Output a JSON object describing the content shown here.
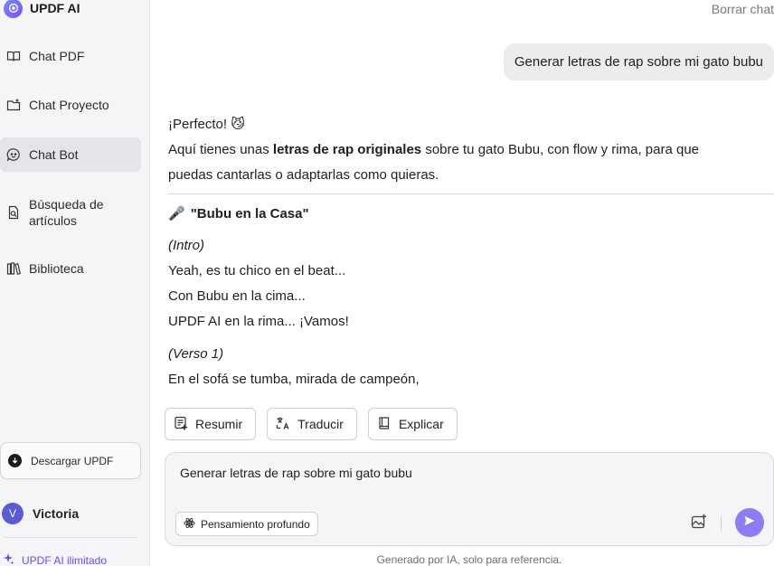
{
  "brand": {
    "name": "UPDF AI"
  },
  "sidebar": {
    "items": [
      {
        "label": "Chat PDF",
        "icon": "book-open-icon"
      },
      {
        "label": "Chat Proyecto",
        "icon": "folder-icon"
      },
      {
        "label": "Chat Bot",
        "icon": "chat-bot-icon",
        "active": true
      },
      {
        "label": "Búsqueda de artículos",
        "icon": "document-search-icon"
      },
      {
        "label": "Biblioteca",
        "icon": "library-icon"
      }
    ],
    "download_label": "Descargar UPDF",
    "user": {
      "initial": "V",
      "name": "Victoria"
    },
    "upgrade_label": "UPDF AI ilimitado"
  },
  "header": {
    "clear_chat": "Borrar chat"
  },
  "conversation": {
    "user_message": "Generar letras de rap sobre mi gato bubu",
    "answer": {
      "line1": "¡Perfecto! 😼",
      "line2_pre": "Aquí tienes unas ",
      "line2_bold": "letras de rap originales",
      "line2_post": " sobre tu gato Bubu, con flow y rima, para que",
      "line3": "puedas cantarlas o adaptarlas como quieras.",
      "song_icon": "🎤",
      "song_title": "\"Bubu en la Casa\"",
      "intro_label": "(Intro)",
      "intro_lines": [
        "Yeah, es tu chico en el beat...",
        "Con Bubu en la cima...",
        "UPDF AI en la rima... ¡Vamos!"
      ],
      "verse_label": "(Verso 1)",
      "verse_lines": [
        "En el sofá se tumba, mirada de campeón,"
      ]
    }
  },
  "actions": {
    "summarize": "Resumir",
    "translate": "Traducir",
    "explain": "Explicar"
  },
  "composer": {
    "value": "Generar letras de rap sobre mi gato bubu",
    "deep_thinking": "Pensamiento profundo"
  },
  "footnote": "Generado por IA, solo para referencia.",
  "colors": {
    "accent": "#8c7cf7",
    "upgrade": "#6a4df4",
    "sidebar_bg": "#f5f5f7"
  }
}
